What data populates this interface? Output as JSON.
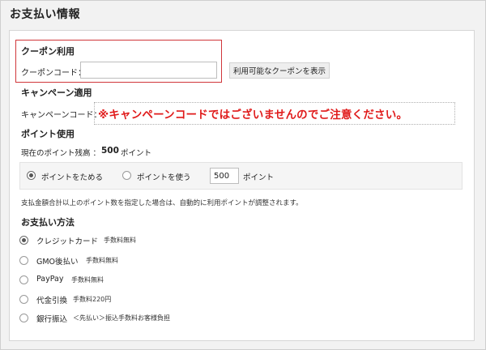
{
  "page": {
    "title": "お支払い情報"
  },
  "coupon": {
    "section_title": "クーポン利用",
    "code_label": "クーポンコード：",
    "code_value": "",
    "button_label": "利用可能なクーポンを表示"
  },
  "campaign": {
    "section_title": "キャンペーン適用",
    "code_label": "キャンペーンコード：",
    "warning": "※キャンペーンコードではございませんのでご注意ください。",
    "warning_color": "#e01a1a"
  },
  "points": {
    "section_title": "ポイント使用",
    "balance_label": "現在のポイント残高 ：",
    "balance_value": "500",
    "balance_unit": "ポイント",
    "option_save": "ポイントをためる",
    "option_use": "ポイントを使う",
    "use_amount": "500",
    "use_unit": "ポイント",
    "selected": "save",
    "note": "支払金額合計以上のポイント数を指定した場合は、自動的に利用ポイントが調整されます。"
  },
  "payment": {
    "section_title": "お支払い方法",
    "methods": [
      {
        "name": "クレジットカード",
        "fee": "手数料無料",
        "selected": true
      },
      {
        "name": "GMO後払い",
        "fee": "手数料無料",
        "selected": false
      },
      {
        "name": "PayPay",
        "fee": "手数料無料",
        "selected": false
      },
      {
        "name": "代金引換",
        "fee": "手数料220円",
        "selected": false
      },
      {
        "name": "銀行振込",
        "fee": "＜先払い＞振込手数料お客様負担",
        "selected": false
      }
    ]
  },
  "colors": {
    "highlight_border": "#d0363a",
    "background": "#f2f2f2",
    "panel": "#ffffff"
  }
}
